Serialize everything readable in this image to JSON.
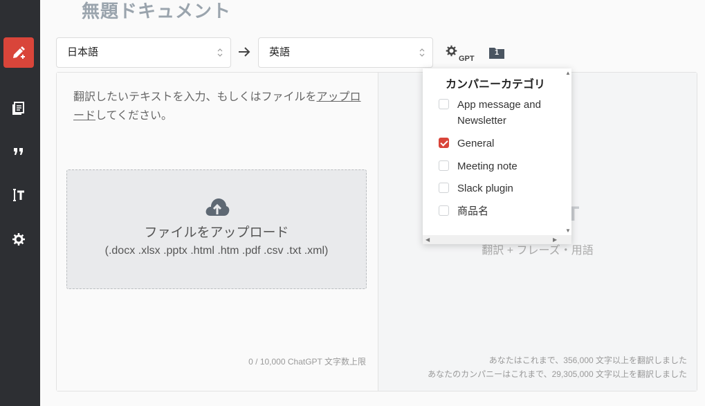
{
  "document": {
    "title": "無題ドキュメント"
  },
  "sidebar": {
    "items": [
      {
        "name": "translate",
        "icon": "pencil-plus-icon",
        "active": true
      },
      {
        "name": "documents",
        "icon": "documents-icon",
        "active": false
      },
      {
        "name": "phrases",
        "icon": "quote-icon",
        "active": false
      },
      {
        "name": "glossary",
        "icon": "text-cursor-icon",
        "active": false
      },
      {
        "name": "settings",
        "icon": "gear-icon",
        "active": false
      }
    ]
  },
  "languages": {
    "source": "日本語",
    "target": "英語"
  },
  "toolbar": {
    "gpt_label": "GPT",
    "folder_count": "1"
  },
  "editor": {
    "placeholder_before": "翻訳したいテキストを入力、もしくはファイルを",
    "placeholder_link": "アップロード",
    "placeholder_after": "してください。",
    "upload_title": "ファイルをアップロード",
    "upload_extensions": "(.docx .xlsx .pptx .html .htm .pdf .csv .txt .xml)",
    "char_count": "0 / 10,000 ChatGPT 文字数上限"
  },
  "output": {
    "partial_mark": "T",
    "subtitle": "翻訳 + フレーズ・用語",
    "stat_personal": "あなたはこれまで、356,000 文字以上を翻訳しました",
    "stat_company": "あなたのカンパニーはこれまで、29,305,000 文字以上を翻訳しました"
  },
  "category_dropdown": {
    "title": "カンパニーカテゴリ",
    "items": [
      {
        "label": "App message and Newsletter",
        "checked": false
      },
      {
        "label": "General",
        "checked": true
      },
      {
        "label": "Meeting note",
        "checked": false
      },
      {
        "label": "Slack plugin",
        "checked": false
      },
      {
        "label": "商品名",
        "checked": false
      }
    ]
  },
  "colors": {
    "accent": "#d9453a",
    "sidebar": "#2d2f33",
    "title": "#9aa4ad"
  }
}
